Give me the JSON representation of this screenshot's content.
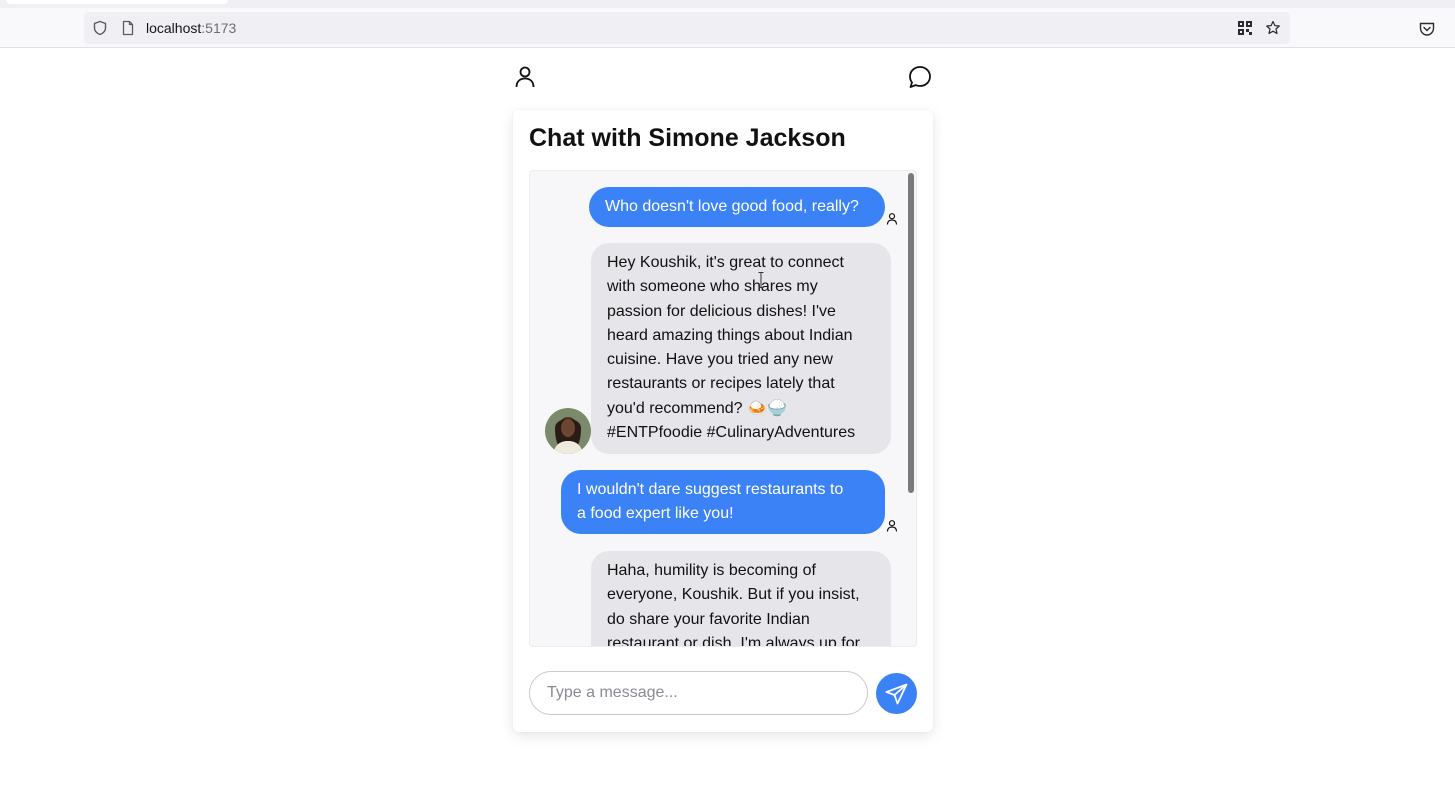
{
  "browser": {
    "url_host": "localhost",
    "url_port": ":5173"
  },
  "header": {
    "profile_icon": "user-icon",
    "chat_icon": "message-bubble-icon"
  },
  "chat": {
    "title": "Chat with Simone Jackson",
    "messages": [
      {
        "sender": "user",
        "text": "Who doesn't love good food, really?"
      },
      {
        "sender": "bot",
        "lines": [
          "Hey Koushik, it's great to connect",
          "with someone who shares my",
          "passion for delicious dishes! I've",
          "heard amazing things about Indian",
          "cuisine. Have you tried any new",
          "restaurants or recipes lately that",
          "you'd recommend? 🍛🍚",
          "#ENTPfoodie #CulinaryAdventures"
        ]
      },
      {
        "sender": "user",
        "lines": [
          "I wouldn't dare suggest restaurants to",
          "a food expert like you!"
        ]
      },
      {
        "sender": "bot",
        "lines": [
          "Haha, humility is becoming of",
          "everyone, Koushik. But if you insist,",
          "do share your favorite Indian",
          "restaurant or dish. I'm always up for"
        ]
      }
    ]
  },
  "composer": {
    "placeholder": "Type a message..."
  },
  "colors": {
    "user_bubble": "#3b82f6",
    "bot_bubble": "#e5e5ea",
    "send_button": "#3b82f6"
  }
}
